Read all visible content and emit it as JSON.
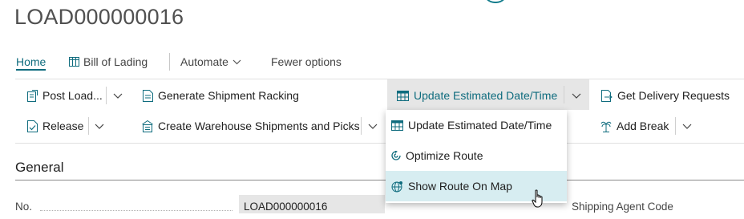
{
  "page": {
    "title": "LOAD000000016"
  },
  "nav": {
    "home": "Home",
    "bill_of_lading": "Bill of Lading",
    "automate": "Automate",
    "fewer_options": "Fewer options"
  },
  "actions": {
    "post_load": "Post Load...",
    "generate_shipment_racking": "Generate Shipment Racking",
    "update_estimated": "Update Estimated Date/Time",
    "get_delivery_requests": "Get Delivery Requests",
    "release": "Release",
    "create_warehouse_shipments": "Create Warehouse Shipments and Picks",
    "add_break": "Add Break"
  },
  "dropdown": {
    "items": [
      {
        "label": "Update Estimated Date/Time"
      },
      {
        "label": "Optimize Route"
      },
      {
        "label": "Show Route On Map"
      }
    ]
  },
  "section": {
    "title": "General"
  },
  "fields": {
    "no_label": "No.",
    "no_value": "LOAD000000016",
    "shipping_agent_label": "Shipping Agent Code"
  },
  "colors": {
    "accent": "#0f6c7e",
    "highlight": "#e6e6e6",
    "hover": "#d7edf1"
  }
}
